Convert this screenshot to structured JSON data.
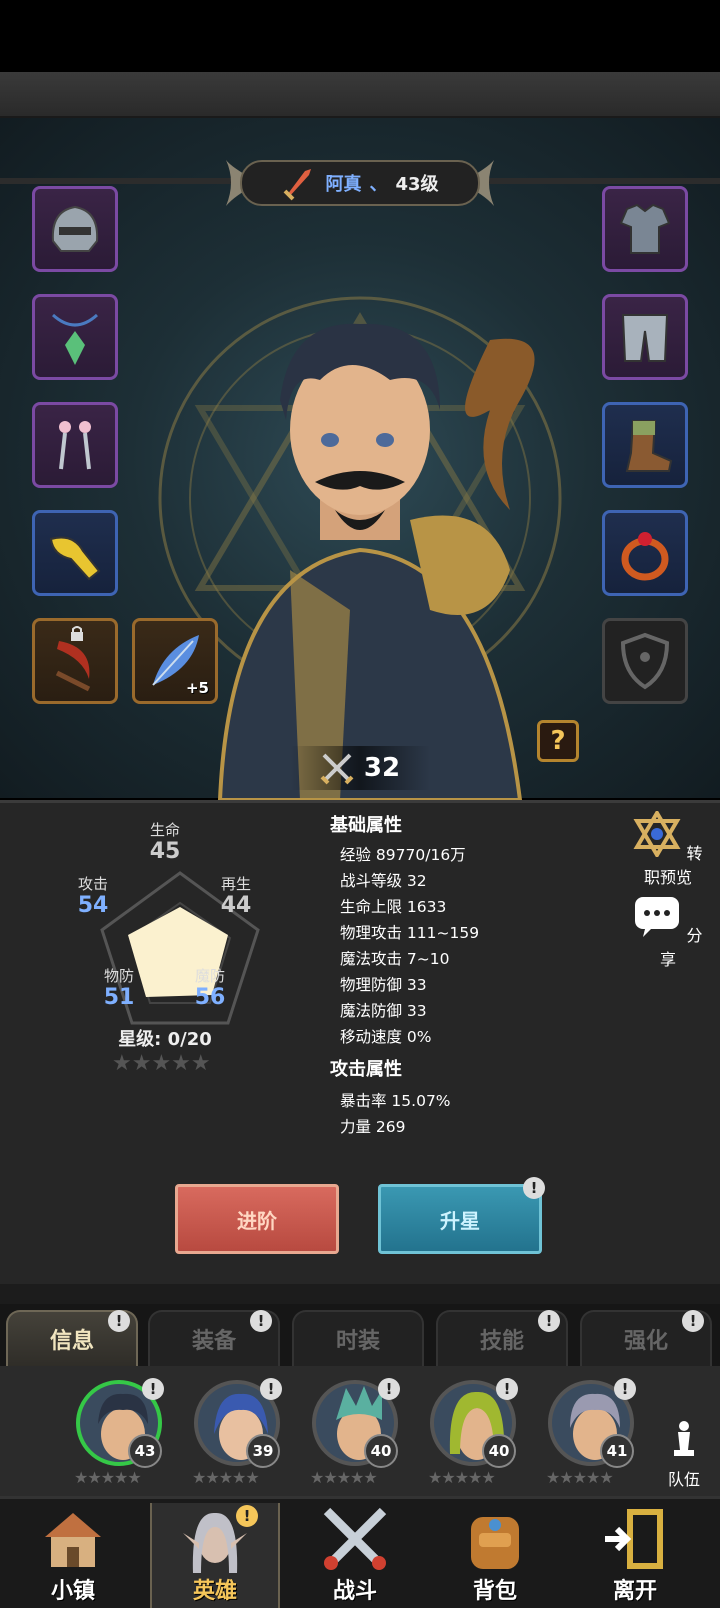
{
  "hero": {
    "name": "阿真",
    "separator": "、",
    "level": "43级",
    "power": "32"
  },
  "equipment": {
    "left": [
      {
        "name": "helmet-icon",
        "rarity": "purple"
      },
      {
        "name": "amulet-icon",
        "rarity": "purple"
      },
      {
        "name": "earrings-icon",
        "rarity": "purple"
      },
      {
        "name": "horn-icon",
        "rarity": "blue"
      }
    ],
    "right": [
      {
        "name": "armor-icon",
        "rarity": "purple"
      },
      {
        "name": "greaves-icon",
        "rarity": "purple"
      },
      {
        "name": "boots-icon",
        "rarity": "blue"
      },
      {
        "name": "ring-icon",
        "rarity": "blue"
      }
    ],
    "feather_plus": "+5"
  },
  "radar": {
    "hp": {
      "label": "生命",
      "value": "45"
    },
    "regen": {
      "label": "再生",
      "value": "44"
    },
    "attack": {
      "label": "攻击",
      "value": "54"
    },
    "pdef": {
      "label": "物防",
      "value": "51"
    },
    "mdef": {
      "label": "魔防",
      "value": "56"
    },
    "star_level": "星级: 0/20"
  },
  "base_attrs": {
    "title": "基础属性",
    "items": [
      "经验 89770/16万",
      "战斗等级 32",
      "生命上限 1633",
      "物理攻击 111~159",
      "魔法攻击 7~10",
      "物理防御 33",
      "魔法防御 33",
      "移动速度 0%"
    ]
  },
  "attack_attrs": {
    "title": "攻击属性",
    "items": [
      "暴击率 15.07%",
      "力量 269"
    ]
  },
  "side": {
    "job_preview": "转职预览",
    "share": "分享"
  },
  "buttons": {
    "advance": "进阶",
    "star_up": "升星"
  },
  "alert_mark": "!",
  "tabs": [
    "信息",
    "装备",
    "时装",
    "技能",
    "强化"
  ],
  "team_heroes": [
    {
      "level": "43"
    },
    {
      "level": "39"
    },
    {
      "level": "40"
    },
    {
      "level": "40"
    },
    {
      "level": "41"
    }
  ],
  "team_label": "队伍",
  "nav": [
    "小镇",
    "英雄",
    "战斗",
    "背包",
    "离开"
  ],
  "stars_glyph": "★★★★★",
  "colors": {
    "accent_blue": "#7fb0ff",
    "gold": "#f5c65a",
    "selected_green": "#35c847"
  }
}
